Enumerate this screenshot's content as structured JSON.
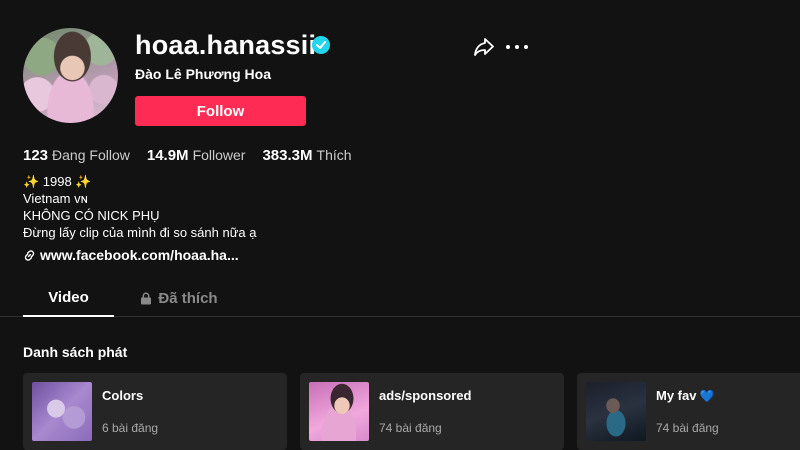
{
  "profile": {
    "username": "hoaa.hanassii",
    "display_name": "Đào Lê Phương Hoa",
    "follow_label": "Follow",
    "verified_icon": "verified-badge-icon",
    "avatar": "profile-photo"
  },
  "actions": {
    "share_icon": "share-arrow-icon",
    "more_icon": "more-options-icon"
  },
  "stats": [
    {
      "value": "123",
      "label": "Đang Follow"
    },
    {
      "value": "14.9M",
      "label": "Follower"
    },
    {
      "value": "383.3M",
      "label": "Thích"
    }
  ],
  "bio": {
    "line1": "✨ 1998 ✨",
    "line2": "Vietnam ᴠɴ",
    "line3": "KHÔNG CÓ NICK PHỤ",
    "line4": "Đừng lấy clip của mình đi so sánh nữa ạ"
  },
  "link": {
    "text": "www.facebook.com/hoaa.ha...",
    "icon": "link-icon"
  },
  "tabs": [
    {
      "label": "Video",
      "active": true
    },
    {
      "label": "Đã thích",
      "active": false,
      "icon": "lock-icon"
    }
  ],
  "playlists_section": {
    "title": "Danh sách phát",
    "items": [
      {
        "name": "Colors",
        "count": "6 bài đăng"
      },
      {
        "name": "ads/sponsored",
        "count": "74 bài đăng"
      },
      {
        "name": "My fav",
        "emoji": "💙",
        "count": "74 bài đăng"
      }
    ]
  },
  "colors": {
    "background": "#121212",
    "follow_button": "#fe2c55",
    "verified": "#20d5ec",
    "card": "#252525"
  }
}
